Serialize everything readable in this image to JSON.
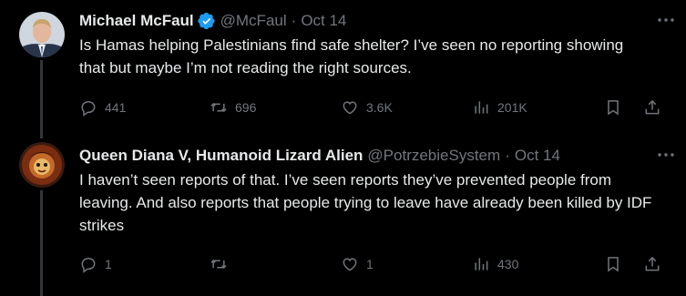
{
  "tweets": [
    {
      "name": "Michael McFaul",
      "verified": true,
      "handle": "@McFaul",
      "time": "Oct 14",
      "text": "Is Hamas helping Palestinians find safe shelter? I’ve seen no reporting showing that but maybe I’m not reading the right sources.",
      "replies": "441",
      "retweets": "696",
      "likes": "3.6K",
      "views": "201K"
    },
    {
      "name": "Queen Diana V, Humanoid Lizard Alien",
      "verified": false,
      "handle": "@PotrzebieSystem",
      "time": "Oct 14",
      "text": "I haven’t seen reports of that. I’ve seen reports they’ve prevented people from leaving. And also reports that people trying to leave have already been killed by IDF strikes",
      "replies": "1",
      "retweets": "",
      "likes": "1",
      "views": "430"
    }
  ],
  "separator": "·",
  "colors": {
    "background": "#000000",
    "text": "#e7e9ea",
    "muted": "#71767b",
    "verified": "#1d9bf0",
    "thread_line": "#333639"
  }
}
